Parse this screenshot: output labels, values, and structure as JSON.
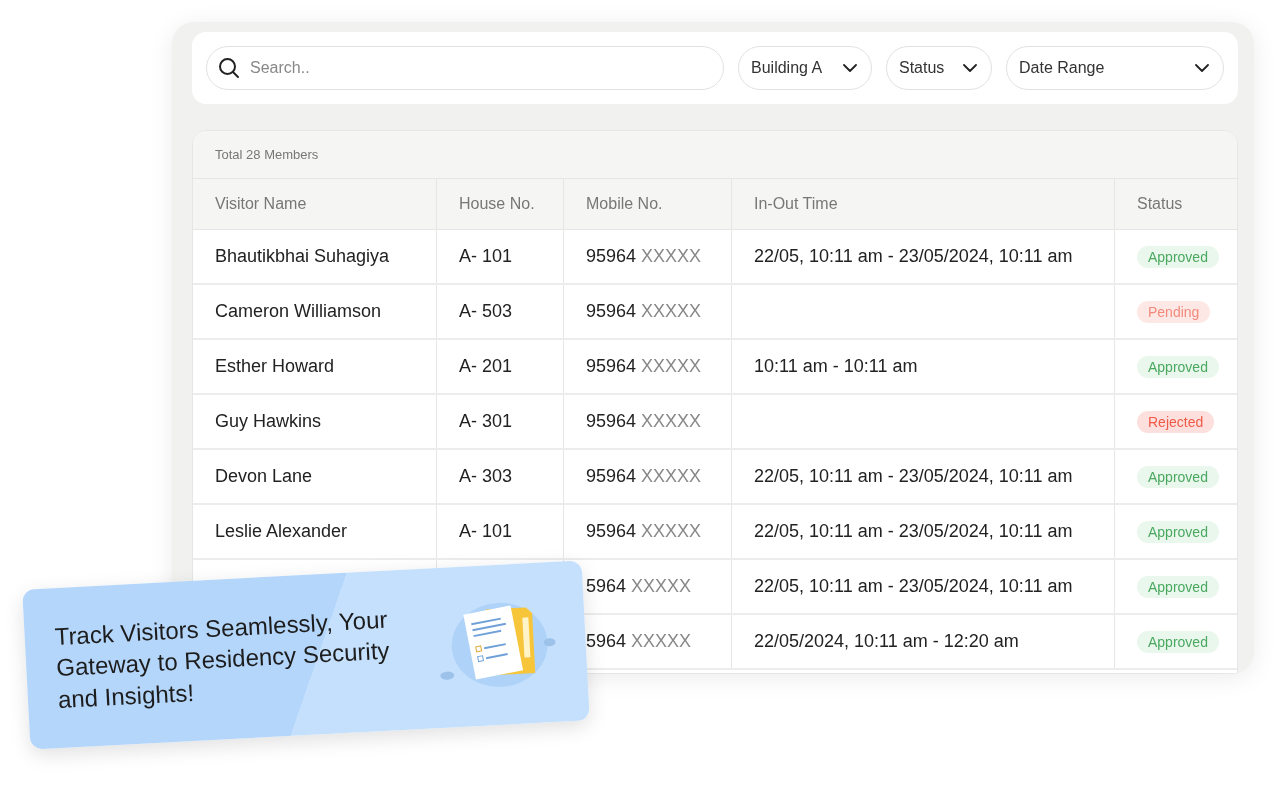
{
  "search": {
    "placeholder": "Search.."
  },
  "filters": [
    {
      "label": "Building A"
    },
    {
      "label": "Status"
    },
    {
      "label": "Date Range"
    }
  ],
  "table": {
    "caption": "Total 28 Members",
    "columns": [
      "Visitor Name",
      "House No.",
      "Mobile No.",
      "In-Out Time",
      "Status"
    ],
    "rows": [
      {
        "name": "Bhautikbhai Suhagiya",
        "house": "A- 101",
        "mobile": {
          "number": "95964",
          "masked": "XXXXX"
        },
        "time": "22/05, 10:11 am - 23/05/2024, 10:11 am",
        "status": {
          "label": "Approved",
          "kind": "approved"
        }
      },
      {
        "name": "Cameron Williamson",
        "house": "A- 503",
        "mobile": {
          "number": "95964",
          "masked": "XXXXX"
        },
        "status": {
          "label": "Pending",
          "kind": "pending"
        }
      },
      {
        "name": "Esther Howard",
        "house": "A- 201",
        "mobile": {
          "number": "95964",
          "masked": "XXXXX"
        },
        "time": "10:11 am - 10:11 am",
        "status": {
          "label": "Approved",
          "kind": "approved"
        }
      },
      {
        "name": "Guy Hawkins",
        "house": "A- 301",
        "mobile": {
          "number": "95964",
          "masked": "XXXXX"
        },
        "status": {
          "label": "Rejected",
          "kind": "rejected"
        }
      },
      {
        "name": "Devon Lane",
        "house": "A- 303",
        "mobile": {
          "number": "95964",
          "masked": "XXXXX"
        },
        "time": "22/05, 10:11 am - 23/05/2024, 10:11 am",
        "status": {
          "label": "Approved",
          "kind": "approved"
        }
      },
      {
        "name": "Leslie Alexander",
        "house": "A- 101",
        "mobile": {
          "number": "95964",
          "masked": "XXXXX"
        },
        "time": "22/05, 10:11 am - 23/05/2024, 10:11 am",
        "status": {
          "label": "Approved",
          "kind": "approved"
        }
      },
      {
        "mobile": {
          "number": "5964",
          "masked": "XXXXX"
        },
        "time": "22/05, 10:11 am - 23/05/2024, 10:11 am",
        "status": {
          "label": "Approved",
          "kind": "approved"
        }
      },
      {
        "mobile": {
          "number": "5964",
          "masked": "XXXXX"
        },
        "time": "22/05/2024, 10:11 am - 12:20 am",
        "status": {
          "label": "Approved",
          "kind": "approved"
        }
      }
    ]
  },
  "banner": {
    "text": "Track Visitors Seamlessly, Your Gateway to Residency Security and Insights!"
  }
}
